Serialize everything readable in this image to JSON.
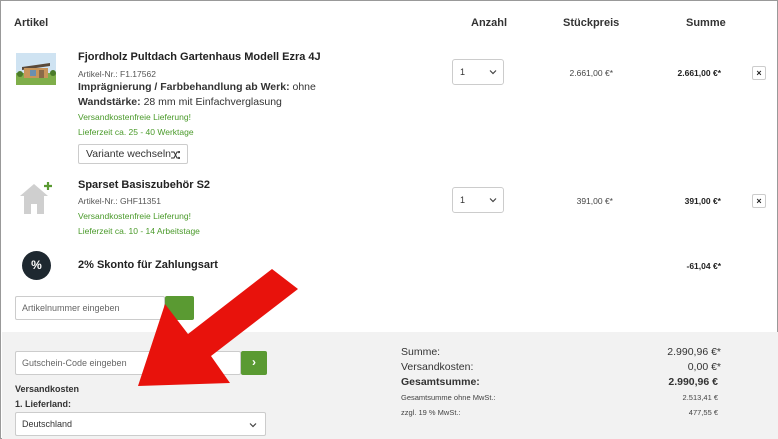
{
  "table": {
    "headers": {
      "artikel": "Artikel",
      "anzahl": "Anzahl",
      "stueckpreis": "Stückpreis",
      "summe": "Summe"
    }
  },
  "items": [
    {
      "title": "Fjordholz Pultdach Gartenhaus Modell Ezra 4J",
      "sku": "Artikel-Nr.: F1.17562",
      "opt1_label": "Imprägnierung / Farbbehandlung ab Werk:",
      "opt1_value": "ohne",
      "opt2_label": "Wandstärke:",
      "opt2_value": "28 mm mit Einfachverglasung",
      "shipping": "Versandkostenfreie Lieferung!",
      "delivery": "Lieferzeit ca. 25 - 40 Werktage",
      "variant_button": "Variante wechseln",
      "qty": "1",
      "unit_price": "2.661,00 €*",
      "sum": "2.661,00 €*",
      "remove": "×"
    },
    {
      "title": "Sparset Basiszubehör S2",
      "sku": "Artikel-Nr.: GHF11351",
      "shipping": "Versandkostenfreie Lieferung!",
      "delivery": "Lieferzeit ca. 10 - 14 Arbeitstage",
      "qty": "1",
      "unit_price": "391,00 €*",
      "sum": "391,00 €*",
      "remove": "×"
    }
  ],
  "discount": {
    "icon_symbol": "%",
    "title": "2% Skonto für Zahlungsart",
    "amount": "-61,04 €*"
  },
  "article_input": {
    "placeholder": "Artikelnummer eingeben"
  },
  "voucher_input": {
    "placeholder": "Gutschein-Code eingeben",
    "button": "›"
  },
  "shipping_section": {
    "title": "Versandkosten",
    "country_label": "1. Lieferland:",
    "country_value": "Deutschland"
  },
  "totals": {
    "summe_label": "Summe:",
    "summe_value": "2.990,96 €*",
    "versand_label": "Versandkosten:",
    "versand_value": "0,00 €*",
    "gesamt_label": "Gesamtsumme:",
    "gesamt_value": "2.990,96 €",
    "netto_label": "Gesamtsumme ohne MwSt.:",
    "netto_value": "2.513,41 €",
    "mwst_label": "zzgl. 19 % MwSt.:",
    "mwst_value": "477,55 €"
  },
  "colors": {
    "accent_green": "#5a9a32",
    "arrow_red": "#e8120c"
  }
}
